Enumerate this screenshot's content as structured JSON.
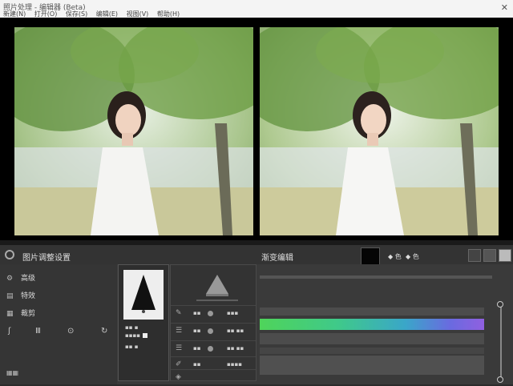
{
  "titlebar": {
    "title": "照片处理 - 编辑器 (Beta)",
    "menu": [
      "新建(N)",
      "打开(O)",
      "保存(S)",
      "编辑(E)",
      "视图(V)",
      "帮助(H)"
    ],
    "close": "✕"
  },
  "panel": {
    "title": "图片调整设置",
    "right_title": "渐变编辑",
    "header_text1": "◆ 色",
    "header_text2": "◆ 色"
  },
  "left_menu": {
    "items": [
      {
        "icon": "gear-icon",
        "glyph": "⚙",
        "label": "高级"
      },
      {
        "icon": "file-icon",
        "glyph": "▤",
        "label": "特效"
      },
      {
        "icon": "layers-icon",
        "glyph": "▦",
        "label": "裁剪"
      }
    ],
    "tools": [
      "ʃ",
      "Ⅲ",
      "⊙",
      "↻"
    ],
    "bottom": "▦▦"
  },
  "preview": {
    "label1": "▪▪ ▪",
    "label2": "▪▪▪▪",
    "label3": "▪▪ ▪"
  },
  "controls": [
    {
      "icon": "pen-icon",
      "glyph": "✎",
      "t1": "▪▪",
      "t2": "▪▪▪"
    },
    {
      "icon": "sliders-icon",
      "glyph": "☰",
      "t1": "▪▪",
      "t2": "▪▪ ▪▪"
    },
    {
      "icon": "sliders-icon",
      "glyph": "☰",
      "t1": "▪▪",
      "t2": "▪▪ ▪▪"
    },
    {
      "icon": "brush-icon",
      "glyph": "✐",
      "t1": "▪▪",
      "t2": "▪▪▪▪"
    },
    {
      "icon": "image-icon",
      "glyph": "◈",
      "t1": "▪▪▪",
      "t2": ""
    }
  ],
  "colors": {
    "accent_green": "#4fd45a",
    "accent_purple": "#9060e0",
    "panel_bg": "#3a3a3a"
  }
}
